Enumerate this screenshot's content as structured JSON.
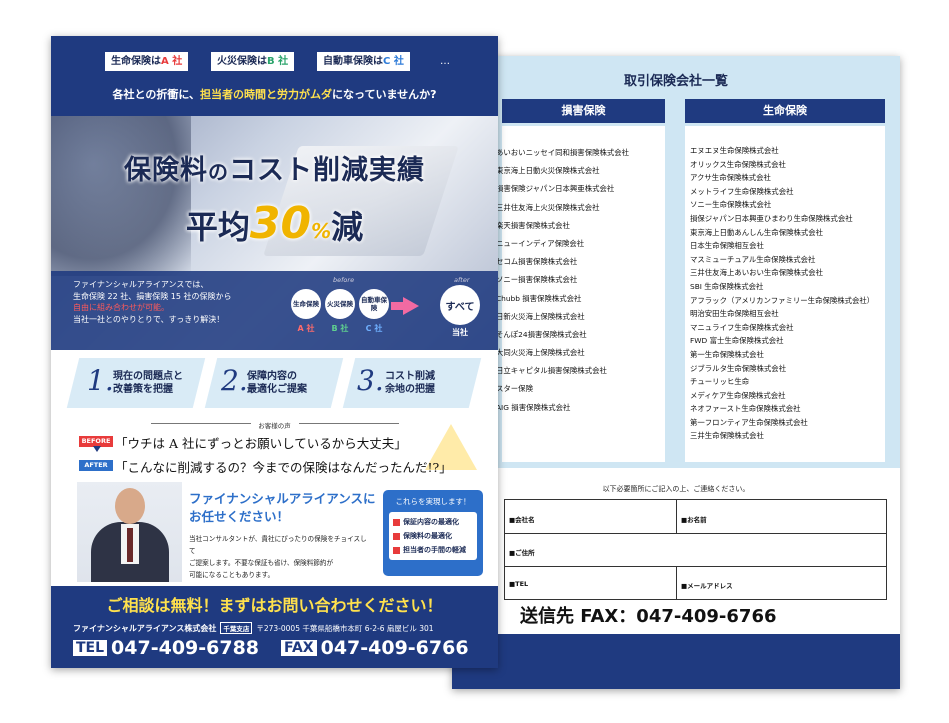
{
  "back": {
    "title": "取引保険会社一覧",
    "nonlife_head": "損害保険",
    "life_head": "生命保険",
    "nonlife": [
      "あいおいニッセイ同和損害保険株式会社",
      "東京海上日動火災保険株式会社",
      "損害保険ジャパン日本興亜株式会社",
      "三井住友海上火災保険株式会社",
      "楽天損害保険株式会社",
      "ニューインディア保険会社",
      "セコム損害保険株式会社",
      "ソニー損害保険株式会社",
      "Chubb 損害保険株式会社",
      "日新火災海上保険株式会社",
      "そんぽ24損害保険株式会社",
      "大同火災海上保険株式会社",
      "日立キャピタル損害保険株式会社",
      "スター保険",
      "AIG 損害保険株式会社"
    ],
    "life": [
      "エヌエヌ生命保険株式会社",
      "オリックス生命保険株式会社",
      "アクサ生命保険株式会社",
      "メットライフ生命保険株式会社",
      "ソニー生命保険株式会社",
      "損保ジャパン日本興亜ひまわり生命保険株式会社",
      "東京海上日動あんしん生命保険株式会社",
      "日本生命保険相互会社",
      "マスミューチュアル生命保険株式会社",
      "三井住友海上あいおい生命保険株式会社",
      "SBI 生命保険株式会社",
      "アフラック（アメリカンファミリー生命保険株式会社）",
      "明治安田生命保険相互会社",
      "マニュライフ生命保険株式会社",
      "FWD 富士生命保険株式会社",
      "第一生命保険株式会社",
      "ジブラルタ生命保険株式会社",
      "チューリッヒ生命",
      "メディケア生命保険株式会社",
      "ネオファースト生命保険株式会社",
      "第一フロンティア生命保険株式会社",
      "三井生命保険株式会社"
    ],
    "note": "以下必要箇所にご記入の上、ご連絡ください。",
    "form": {
      "company": "■会社名",
      "name": "■お名前",
      "address": "■ご住所",
      "tel": "■TEL",
      "email": "■メールアドレス"
    },
    "fax": "送信先 FAX：047-409-6766"
  },
  "front": {
    "tags": {
      "life": "生命保険は",
      "life_co": "A 社",
      "fire": "火災保険は",
      "fire_co": "B 社",
      "auto": "自動車保険は",
      "auto_co": "C 社",
      "dots": "…"
    },
    "sub_pre": "各社との折衝に、",
    "sub_hl": "担当者の時間と労力がムダ",
    "sub_post": "になっていませんか?",
    "hero_title_a": "保険料",
    "hero_title_b": "の",
    "hero_title_c": "コスト削減実績",
    "hero_avg_pre": "平均",
    "hero_avg_num": "30",
    "hero_avg_pct": "%",
    "hero_avg_post": "減",
    "panel_text_1": "ファイナンシャルアライアンスでは、",
    "panel_text_2": "生命保険 22 社、損害保険 15 社の保険から",
    "panel_text_3": "自由に組み合わせが可能。",
    "panel_text_4": "当社一社とのやりとりで、すっきり解決！",
    "before": "before",
    "after": "after",
    "c1": "生命保険",
    "c2": "火災保険",
    "c3": "自動車保険",
    "c1_lbl": "A 社",
    "c2_lbl": "B 社",
    "c3_lbl": "C 社",
    "all": "すべて",
    "all_lbl": "当社",
    "steps": [
      {
        "num": "1.",
        "l1": "現在の問題点と",
        "l2": "改善策を把握"
      },
      {
        "num": "2.",
        "l1": "保障内容の",
        "l2": "最適化ご提案"
      },
      {
        "num": "3.",
        "l1": "コスト削減",
        "l2": "余地の把握"
      }
    ],
    "voice_title": "お客様の声",
    "before_badge": "BEFORE",
    "after_badge": "AFTER",
    "quote_before": "「ウチは A 社にずっとお願いしているから大丈夫」",
    "quote_after": "「こんなに削減するの？今までの保険はなんだったんだ!?」",
    "fa_title_1": "ファイナンシャルアライアンスに",
    "fa_title_2": "お任せください！",
    "fa_body_1": "当社コンサルタントが、貴社にぴったりの保険をチョイスして",
    "fa_body_2": "ご提案します。不要な保証も省け、保険料節約が",
    "fa_body_3": "可能になることもあります。",
    "merit_title": "これらを実現します！",
    "merits": [
      "保証内容の最適化",
      "保険料の最適化",
      "担当者の手間の軽減"
    ],
    "consult": "ご相談は無料！まずはお問い合わせください！",
    "company": "ファイナンシャルアライアンス株式会社",
    "branch": "千葉支店",
    "address": "〒273-0005 千葉県船橋市本町 6-2-6 扇屋ビル 301",
    "tel_label": "TEL",
    "tel": "047-409-6788",
    "fax_label": "FAX",
    "fax": "047-409-6766"
  },
  "colors": {
    "navy": "#1f3a80",
    "accent_yellow": "#ffe14d",
    "light_blue": "#cfe6f3",
    "red": "#e83b3b"
  }
}
